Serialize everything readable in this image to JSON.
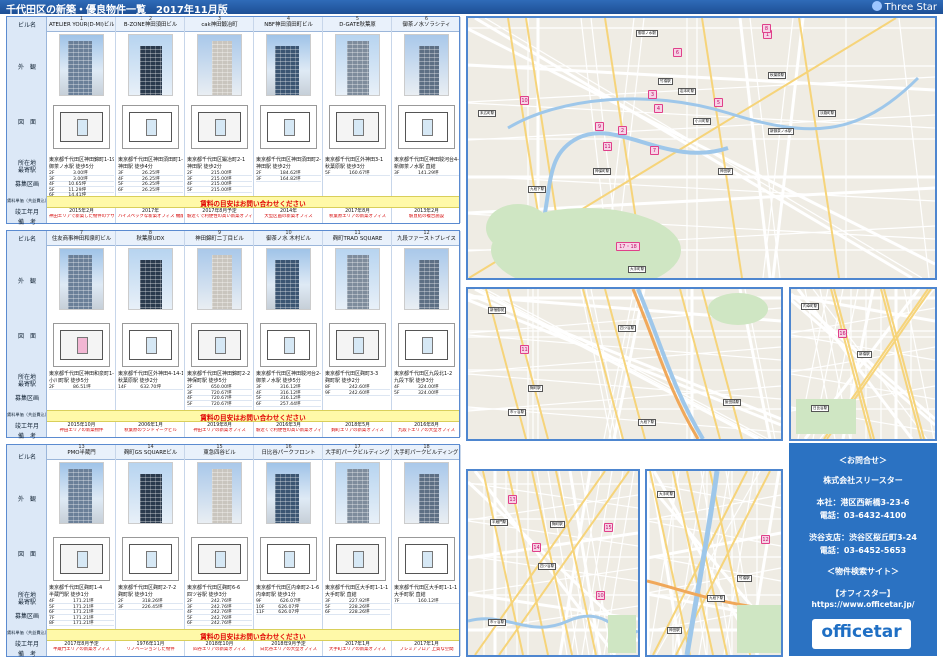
{
  "header": {
    "title": "千代田区の新築・優良物件一覧　2017年11月版",
    "brand": "Three Star"
  },
  "row_labels": {
    "building": "ビル名",
    "exterior": "外　観",
    "plan": "図　面",
    "address": "所在地",
    "station": "最寄駅",
    "vacancy": "募集区画",
    "price": "賃料単価（共益費込）",
    "completion": "竣工年月",
    "remarks": "備　考"
  },
  "inquiry_note": "賃料の目安はお問い合わせください",
  "panels": [
    {
      "buildings": [
        {
          "num": "1",
          "name": "ATELIER YOUR(D-MI)ビル",
          "address": "東京都千代田区神田錦町1-19-1",
          "station": "御茶ノ水駅 徒歩5分",
          "rows": [
            "2F　　　　3.00坪",
            "3F　　　　3.00坪",
            "4F　　　10.65坪",
            "5F　　　11.29坪",
            "6F　　　14.41坪"
          ],
          "date": "2015年2月",
          "note": "神田エリアで新築した物件のデザイナーズオフィス"
        },
        {
          "num": "2",
          "name": "B-ZONE神田須田ビル",
          "address": "東京都千代田区神田須田町1-26",
          "station": "神田駅 徒歩4分",
          "rows": [
            "3F　　　　26.25坪",
            "4F　　　　26.25坪",
            "5F　　　　26.25坪",
            "6F　　　　26.25坪"
          ],
          "date": "2017年",
          "note": "ハイスペックな新築オフィス 機能的なレイアウト"
        },
        {
          "num": "3",
          "name": "cak神田鍛冶町",
          "address": "東京都千代田区鍛冶町2-1",
          "station": "神田駅 徒歩2分",
          "rows": [
            "2F　　　　215.00坪",
            "3F　　　　215.00坪",
            "4F　　　　215.00坪",
            "5F　　　　215.00坪"
          ],
          "date": "2017年8月予定",
          "note": "駅近くで利便性の高い新築オフィス"
        },
        {
          "num": "4",
          "name": "NBF神田須田町ビル",
          "address": "東京都千代田区神田須田町2-1",
          "station": "神田駅 徒歩2分",
          "rows": [
            "2F　　　　184.62坪",
            "3F　　　　164.82坪"
          ],
          "date": "2014年",
          "note": "大型区画の新築オフィス"
        },
        {
          "num": "5",
          "name": "D-GATE秋葉原",
          "address": "東京都千代田区外神田3-1",
          "station": "秋葉原駅 徒歩3分",
          "rows": [
            "5F　　　　160.67坪"
          ],
          "date": "2017年8月",
          "note": "秋葉原エリアの新築オフィス"
        },
        {
          "num": "6",
          "name": "御茶ノ水ソラシティ",
          "address": "東京都千代田区神田駿河台4-6",
          "station": "新御茶ノ水駅 直結",
          "rows": [
            "3F　　　　141.29坪"
          ],
          "date": "2013年2月",
          "note": "駅直結の複合施設"
        }
      ]
    },
    {
      "buildings": [
        {
          "num": "7",
          "name": "住友商事神田和泉町ビル",
          "address": "東京都千代田区神田和泉町1-1",
          "station": "小川町駅 徒歩5分",
          "rows": [
            "2F　　　　86.51坪"
          ],
          "date": "2015年10月",
          "note": "神田エリアの新築物件"
        },
        {
          "num": "8",
          "name": "秋葉原UDX",
          "address": "東京都千代田区外神田4-14-1",
          "station": "秋葉原駅 徒歩2分",
          "rows": [
            "14F　　　632.70坪"
          ],
          "date": "2006年1月",
          "note": "秋葉原のランドマークビル"
        },
        {
          "num": "9",
          "name": "神田錦町二丁目ビル",
          "address": "東京都千代田区神田錦町2-2",
          "station": "神保町駅 徒歩5分",
          "rows": [
            "2F　　　　650.00坪",
            "3F　　　　720.67坪",
            "4F　　　　720.67坪",
            "5F　　　　720.67坪"
          ],
          "date": "2019年8月",
          "note": "神田エリアの新築オフィス"
        },
        {
          "num": "10",
          "name": "御茶ノ水 木村ビル",
          "address": "東京都千代田区神田駿河台2-7-5",
          "station": "御茶ノ水駅 徒歩5分",
          "rows": [
            "3F　　　　316.12坪",
            "4F　　　　316.12坪",
            "5F　　　　316.12坪",
            "6F　　　　257.44坪"
          ],
          "date": "2016年3月",
          "note": "駅近くで利便性の高い新築オフィス"
        },
        {
          "num": "11",
          "name": "麹町TRAD SQUARE",
          "address": "東京都千代田区麹町3-3",
          "station": "麹町駅 徒歩2分",
          "rows": [
            "8F　　　　242.60坪",
            "9F　　　　242.60坪"
          ],
          "date": "2018年5月",
          "note": "麹町エリアの新築オフィス"
        },
        {
          "num": "12",
          "name": "九段ファーストプレイス",
          "address": "東京都千代田区九段北1-2",
          "station": "九段下駅 徒歩3分",
          "rows": [
            "4F　　　　324.00坪",
            "5F　　　　324.00坪"
          ],
          "date": "2016年8月",
          "note": "九段下エリアの大型オフィス"
        }
      ]
    },
    {
      "buildings": [
        {
          "num": "13",
          "name": "PMO半蔵門",
          "address": "東京都千代田区麹町1-4",
          "station": "半蔵門駅 徒歩1分",
          "rows": [
            "4F　　　　171.21坪",
            "5F　　　　171.21坪",
            "6F　　　　171.21坪",
            "7F　　　　171.21坪",
            "8F　　　　171.21坪"
          ],
          "date": "2017年8月予定",
          "note": "半蔵門エリアの新築オフィス"
        },
        {
          "num": "14",
          "name": "麹町GS SQUAREビル",
          "address": "東京都千代田区麹町2-7-2",
          "station": "麹町駅 徒歩1分",
          "rows": [
            "2F　　　　318.26坪",
            "3F　　　　226.45坪"
          ],
          "date": "1976年11月",
          "note": "リノベーションした物件"
        },
        {
          "num": "15",
          "name": "東急四谷ビル",
          "address": "東京都千代田区麹町6-6",
          "station": "四ツ谷駅 徒歩3分",
          "rows": [
            "2F　　　　242.76坪",
            "3F　　　　242.76坪",
            "4F　　　　242.76坪",
            "5F　　　　242.76坪",
            "6F　　　　242.76坪"
          ],
          "date": "2018年10月",
          "note": "四谷エリアの新築オフィス"
        },
        {
          "num": "16",
          "name": "日比谷パークフロント",
          "address": "東京都千代田区内幸町2-1-6",
          "station": "内幸町駅 徒歩1分",
          "rows": [
            "9F　　　　626.07坪",
            "10F　　　626.07坪",
            "11F　　　626.07坪"
          ],
          "date": "2018年9月予定",
          "note": "日比谷エリアの大型オフィス"
        },
        {
          "num": "17",
          "name": "大手町パークビルディング",
          "address": "東京都千代田区大手町1-1-1",
          "station": "大手町駅 直結",
          "rows": [
            "3F　　　　227.92坪",
            "5F　　　　228.26坪",
            "6F　　　　228.26坪"
          ],
          "date": "2017年1月",
          "note": "大手町エリアの新築オフィス"
        },
        {
          "num": "18",
          "name": "大手町パークビルディング（ブレミアフロア）",
          "address": "東京都千代田区大手町1-1-1",
          "station": "大手町駅 直結",
          "rows": [
            "7F　　　　160.12坪"
          ],
          "date": "2017年1月",
          "note": "ブレミアフロア 上質な空間"
        }
      ]
    }
  ],
  "maps": {
    "main_pins": [
      "1",
      "2",
      "3",
      "4",
      "5",
      "6",
      "7",
      "8",
      "9",
      "10",
      "11",
      "17・18"
    ],
    "main_labels": [
      "御茶ノ水駅",
      "秋葉原駅",
      "神田駅",
      "小川町駅",
      "神保町駅",
      "大手町駅",
      "九段下駅",
      "竹橋駅",
      "淡路町駅",
      "新御茶ノ水駅",
      "岩本町駅",
      "末広町駅"
    ],
    "mid_pins": [
      "11"
    ],
    "mid_labels": [
      "新宿御苑",
      "市ヶ谷駅",
      "四ツ谷駅",
      "麹町駅",
      "九段下駅",
      "飯田橋駅"
    ],
    "right_pins": [
      "16"
    ],
    "right_labels": [
      "内幸町駅",
      "新橋駅",
      "日比谷駅"
    ],
    "bl_pins": [
      "13",
      "14",
      "15",
      "10"
    ],
    "bl_labels": [
      "半蔵門駅",
      "麹町駅",
      "四ツ谷駅",
      "市ヶ谷駅"
    ],
    "br_pins": [
      "12"
    ],
    "br_labels": [
      "大手町駅",
      "竹橋駅",
      "九段下駅",
      "神田駅"
    ]
  },
  "contact": {
    "heading": "＜お問合せ＞",
    "company": "株式会社スリースター",
    "head_office": "本社：港区西新橋3-23-6",
    "head_tel": "電話：03-6432-4100",
    "branch": "渋谷支店：渋谷区桜丘町3-24",
    "branch_tel": "電話：03-6452-5653",
    "site_heading": "＜物件検索サイト＞",
    "site_name": "【オフィスター】",
    "site_url": "https://www.officetar.jp/",
    "logo": "officetar"
  }
}
